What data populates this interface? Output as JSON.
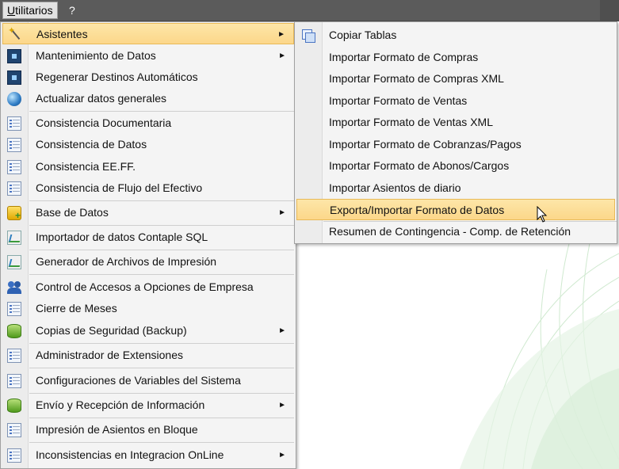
{
  "menubar": {
    "items": [
      {
        "label_ul": "U",
        "label_rest": "tilitarios"
      },
      {
        "label": "?"
      }
    ]
  },
  "menu": {
    "items": [
      {
        "label": "Asistentes",
        "icon": "magic-wand-icon",
        "submenu": true,
        "highlighted": true
      },
      {
        "label": "Mantenimiento de Datos",
        "icon": "maintenance-icon",
        "submenu": true
      },
      {
        "label": "Regenerar Destinos Automáticos",
        "icon": "regenerate-icon"
      },
      {
        "label": "Actualizar datos generales",
        "icon": "globe-icon"
      },
      {
        "label": "Consistencia Documentaria",
        "icon": "document-list-icon"
      },
      {
        "label": "Consistencia de Datos",
        "icon": "document-list-icon"
      },
      {
        "label": "Consistencia EE.FF.",
        "icon": "document-list-icon"
      },
      {
        "label": "Consistencia de Flujo del Efectivo",
        "icon": "document-list-icon"
      },
      {
        "label": "Base de Datos",
        "icon": "database-add-icon",
        "submenu": true
      },
      {
        "label": "Importador de datos Contaple SQL",
        "icon": "chart-icon"
      },
      {
        "label": "Generador de Archivos de Impresión",
        "icon": "chart-icon"
      },
      {
        "label": "Control de Accesos a Opciones de Empresa",
        "icon": "users-icon"
      },
      {
        "label": "Cierre de Meses",
        "icon": "document-list-icon"
      },
      {
        "label": "Copias de Seguridad (Backup)",
        "icon": "database-icon",
        "submenu": true
      },
      {
        "label": "Administrador de Extensiones",
        "icon": "document-list-icon"
      },
      {
        "label": "Configuraciones de Variables del Sistema",
        "icon": "document-list-icon"
      },
      {
        "label": "Envío y Recepción de Información",
        "icon": "database-icon",
        "submenu": true
      },
      {
        "label": "Impresión de Asientos en Bloque",
        "icon": "document-list-icon"
      },
      {
        "label": "Inconsistencias en Integracion OnLine",
        "icon": "document-list-icon",
        "submenu": true
      }
    ],
    "submenu_arrow": "►"
  },
  "submenu": {
    "items": [
      {
        "label": "Copiar Tablas",
        "icon": "copy-tables-icon"
      },
      {
        "label": "Importar Formato de Compras"
      },
      {
        "label": "Importar Formato de Compras XML"
      },
      {
        "label": "Importar Formato de Ventas"
      },
      {
        "label": "Importar Formato de Ventas XML"
      },
      {
        "label": "Importar Formato de Cobranzas/Pagos"
      },
      {
        "label": "Importar Formato de Abonos/Cargos"
      },
      {
        "label": "Importar Asientos de diario"
      },
      {
        "label": "Exporta/Importar Formato de Datos",
        "highlighted": true
      },
      {
        "label": "Resumen de Contingencia - Comp. de Retención"
      }
    ]
  },
  "colors": {
    "menubar_bg": "#5b5b5b",
    "highlight": "#fcd78a",
    "menu_bg": "#f4f4f4"
  }
}
